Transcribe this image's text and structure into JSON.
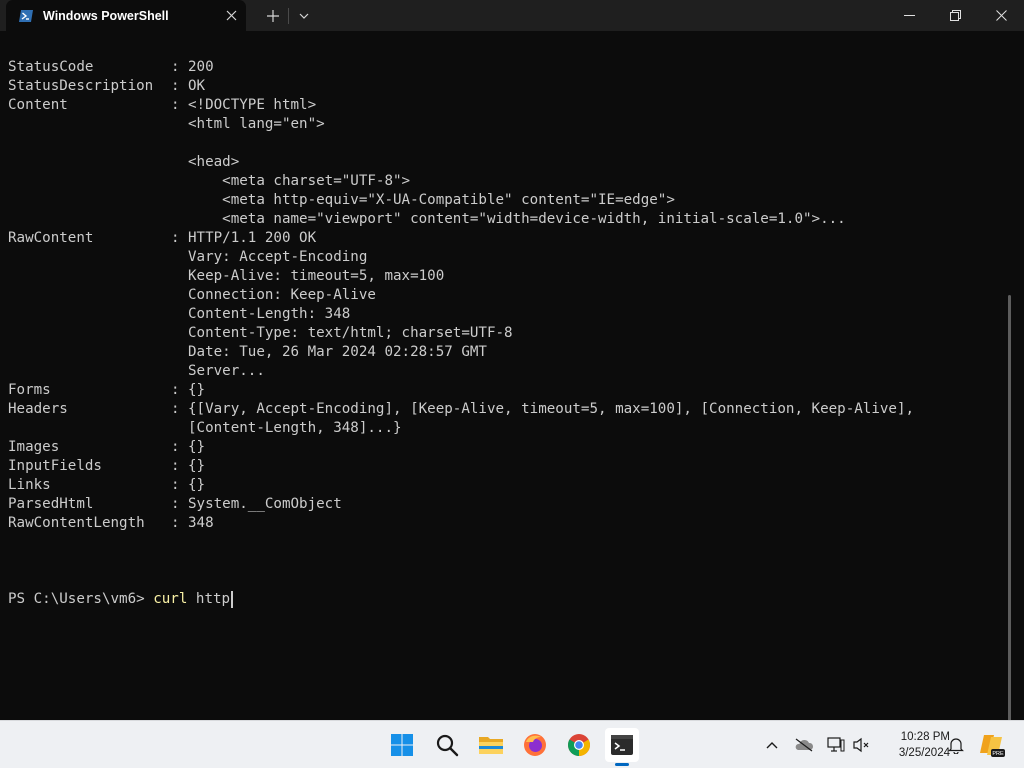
{
  "window": {
    "tab_title": "Windows PowerShell",
    "tab_icon": "powershell-icon"
  },
  "console": {
    "properties": [
      {
        "key": "StatusCode",
        "value": "200"
      },
      {
        "key": "StatusDescription",
        "value": "OK"
      },
      {
        "key": "Content",
        "value": "<!DOCTYPE html>",
        "continuation": [
          "<html lang=\"en\">",
          "",
          "<head>",
          "    <meta charset=\"UTF-8\">",
          "    <meta http-equiv=\"X-UA-Compatible\" content=\"IE=edge\">",
          "    <meta name=\"viewport\" content=\"width=device-width, initial-scale=1.0\">..."
        ]
      },
      {
        "key": "RawContent",
        "value": "HTTP/1.1 200 OK",
        "continuation": [
          "Vary: Accept-Encoding",
          "Keep-Alive: timeout=5, max=100",
          "Connection: Keep-Alive",
          "Content-Length: 348",
          "Content-Type: text/html; charset=UTF-8",
          "Date: Tue, 26 Mar 2024 02:28:57 GMT",
          "Server..."
        ]
      },
      {
        "key": "Forms",
        "value": "{}"
      },
      {
        "key": "Headers",
        "value": "{[Vary, Accept-Encoding], [Keep-Alive, timeout=5, max=100], [Connection, Keep-Alive],",
        "continuation": [
          "[Content-Length, 348]...}"
        ]
      },
      {
        "key": "Images",
        "value": "{}"
      },
      {
        "key": "InputFields",
        "value": "{}"
      },
      {
        "key": "Links",
        "value": "{}"
      },
      {
        "key": "ParsedHtml",
        "value": "System.__ComObject"
      },
      {
        "key": "RawContentLength",
        "value": "348"
      }
    ],
    "separator": ":",
    "prompt": "PS C:\\Users\\vm6> ",
    "command": "curl",
    "argument": " http"
  },
  "taskbar": {
    "apps": [
      "windows-start-icon",
      "search-icon",
      "file-explorer-icon",
      "firefox-icon",
      "chrome-icon",
      "terminal-icon"
    ],
    "time": "10:28 PM",
    "date": "3/25/2024",
    "copilot_badge": "PRE"
  }
}
